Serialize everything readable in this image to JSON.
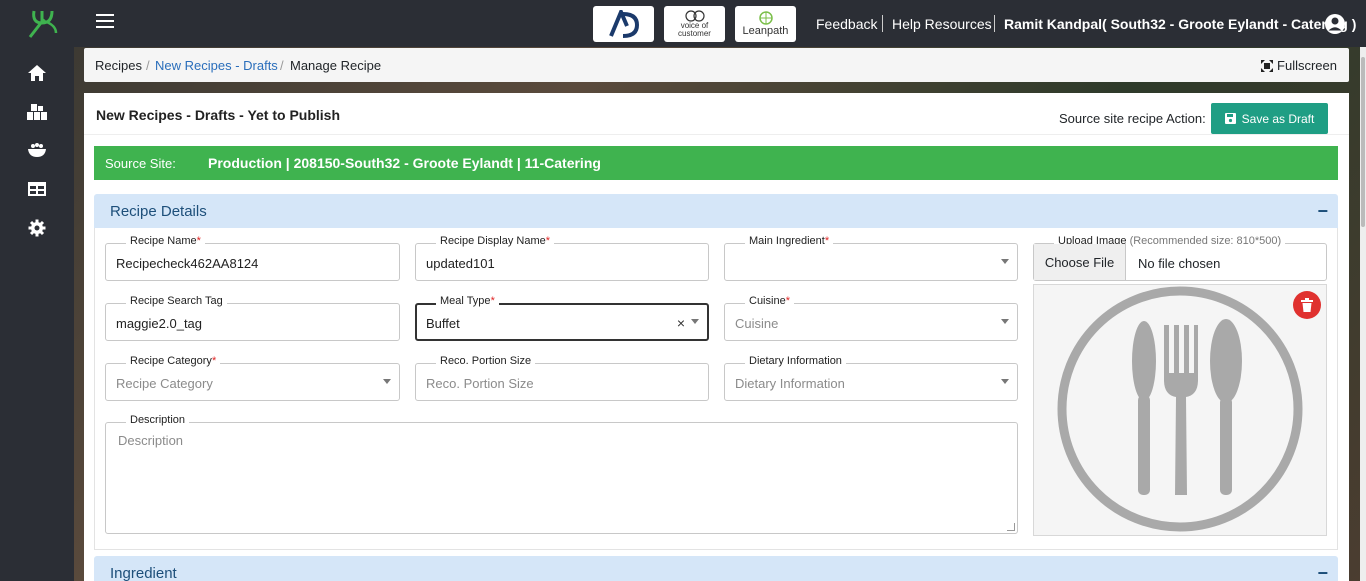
{
  "colors": {
    "sidebar": "#2b2e35",
    "accent_green": "#3fb34f",
    "teal_button": "#1f9e84",
    "section_blue": "#d5e6f8",
    "danger": "#e0312f"
  },
  "sidebar": {
    "logo_icon": "fork-leaf-logo-icon",
    "items": [
      {
        "icon": "home-icon"
      },
      {
        "icon": "boxes-icon"
      },
      {
        "icon": "bowl-icon"
      },
      {
        "icon": "table-icon"
      },
      {
        "icon": "gear-icon"
      }
    ]
  },
  "topbar": {
    "partners": [
      {
        "name": "AD",
        "icon": "ad-logo-icon"
      },
      {
        "line1": "voice of",
        "line2": "customer",
        "icon": "voice-of-customer-logo-icon"
      },
      {
        "name": "Leanpath",
        "icon": "leanpath-logo-icon"
      }
    ],
    "links": [
      "Feedback",
      "Help Resources"
    ],
    "user": "Ramit Kandpal( South32 - Groote Eylandt - Catering )"
  },
  "breadcrumb": {
    "items": [
      "Recipes",
      "New Recipes - Drafts",
      "Manage Recipe"
    ],
    "fullscreen": "Fullscreen"
  },
  "card": {
    "title": "New Recipes - Drafts - Yet to Publish",
    "source_action_label": "Source site recipe Action:",
    "save_draft_label": "Save as Draft",
    "source_label": "Source Site:",
    "source_value": "Production | 208150-South32 - Groote Eylandt | 11-Catering"
  },
  "recipe_details": {
    "title": "Recipe Details",
    "toggle": "−",
    "fields": {
      "recipe_name": {
        "label": "Recipe Name",
        "value": "Recipecheck462AA8124"
      },
      "display_name": {
        "label": "Recipe Display Name",
        "value": "updated101"
      },
      "main_ingredient": {
        "label": "Main Ingredient",
        "value": ""
      },
      "search_tag": {
        "label": "Recipe Search Tag",
        "value": "maggie2.0_tag"
      },
      "meal_type": {
        "label": "Meal Type",
        "value": "Buffet",
        "clear": "×"
      },
      "cuisine": {
        "label": "Cuisine",
        "placeholder": "Cuisine"
      },
      "category": {
        "label": "Recipe Category",
        "placeholder": "Recipe Category"
      },
      "portion": {
        "label": "Reco. Portion Size",
        "placeholder": "Reco. Portion Size"
      },
      "dietary": {
        "label": "Dietary Information",
        "placeholder": "Dietary Information"
      },
      "description": {
        "label": "Description",
        "placeholder": "Description"
      }
    },
    "required_mark": "*",
    "upload": {
      "label": "Upload Image",
      "hint": "(Recommended size: 810*500)",
      "choose": "Choose File",
      "status": "No file chosen"
    }
  },
  "ingredient": {
    "title": "Ingredient",
    "toggle": "−"
  }
}
